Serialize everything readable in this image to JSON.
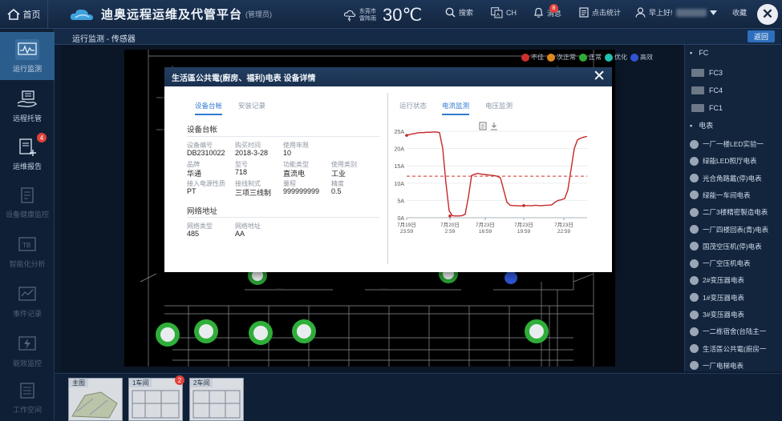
{
  "topbar": {
    "home_label": "首页",
    "title": "迪奥远程运维及代管平台",
    "subtitle": "(管理员)",
    "weather_city": "东莞市",
    "weather_desc": "雷阵雨",
    "temperature": "30℃",
    "search_label": "搜索",
    "lang_label": "CH",
    "messages_label": "消息",
    "messages_count": "8",
    "stats_label": "点击统计",
    "greeting": "早上好!",
    "favorite_label": "收藏"
  },
  "sidebar": {
    "items": [
      {
        "label": "运行监测"
      },
      {
        "label": "远程托管"
      },
      {
        "label": "运维报告",
        "badge": "4"
      },
      {
        "label": "设备健康监控"
      },
      {
        "label": "智能化分析"
      },
      {
        "label": "事件记录"
      },
      {
        "label": "能效监控"
      },
      {
        "label": "工作空间"
      }
    ]
  },
  "breadcrumb": {
    "text": "运行监测 - 传感器",
    "back_label": "返回"
  },
  "legend": [
    {
      "label": "不佳",
      "color": "#d0312d"
    },
    {
      "label": "次正常",
      "color": "#e08a1e"
    },
    {
      "label": "正常",
      "color": "#2fae3a"
    },
    {
      "label": "优化",
      "color": "#20c2b4"
    },
    {
      "label": "高效",
      "color": "#2f55d4"
    }
  ],
  "right_panel": {
    "group1": "FC",
    "fc_items": [
      "FC3",
      "FC4",
      "FC1"
    ],
    "group2": "电表",
    "meters": [
      "一厂一楼LED实验一",
      "绿能LED照厅电表",
      "光合角路戴(停)电表",
      "绿能一车间电表",
      "二厂3楼精密製造电表",
      "一厂四楼回表(青)电表",
      "国茂空压机(停)电表",
      "一厂空压机电表",
      "2#变压器电表",
      "1#变压器电表",
      "3#变压器电表",
      "一二栋宿舍(台陆主一",
      "生活區公共電(廚房一",
      "一厂电梯电表"
    ]
  },
  "bottom": {
    "thumbs": [
      {
        "label": "主图"
      },
      {
        "label": "1车间",
        "badge": "2"
      },
      {
        "label": "2车间"
      }
    ]
  },
  "modal": {
    "title": "生活區公共電(廚房、福利)电表 设备详情",
    "left_tabs": [
      "设备台帐",
      "安装记录"
    ],
    "section1": "设备台帐",
    "fields": [
      {
        "label": "设备编号",
        "value": "DB2310022"
      },
      {
        "label": "购买时间",
        "value": "2018-3-28"
      },
      {
        "label": "使用年限",
        "value": "10"
      },
      {
        "label": "品牌",
        "value": "华通"
      },
      {
        "label": "型号",
        "value": "718"
      },
      {
        "label": "功能类型",
        "value": "直流电"
      },
      {
        "label": "使用类别",
        "value": "工业"
      },
      {
        "label": "接入电源性质",
        "value": "PT"
      },
      {
        "label": "接线制式",
        "value": "三项三线制"
      },
      {
        "label": "量程",
        "value": "999999999"
      },
      {
        "label": "精度",
        "value": "0.5"
      }
    ],
    "section2": "网络地址",
    "net_fields": [
      {
        "label": "网络类型",
        "value": "485"
      },
      {
        "label": "网络地址",
        "value": "AA"
      }
    ],
    "right_tabs": [
      "运行状态",
      "电流监测",
      "电压监测"
    ],
    "active_right_tab": 1
  },
  "chart_data": {
    "type": "line",
    "y_ticks": [
      "25A",
      "20A",
      "15A",
      "10A",
      "5A",
      "0A"
    ],
    "ylim": [
      0,
      25
    ],
    "x_ticks": [
      [
        "7月19日",
        "23:59"
      ],
      [
        "7月20日",
        "2:59"
      ],
      [
        "7月23日",
        "16:59"
      ],
      [
        "7月23日",
        "19:59"
      ],
      [
        "7月23日",
        "22:59"
      ]
    ],
    "series": [
      {
        "x": [
          0,
          3,
          6,
          9,
          13,
          17,
          21,
          25,
          29,
          33,
          37,
          41,
          45,
          49,
          53,
          57,
          61,
          65,
          69,
          73,
          77,
          81,
          85,
          89,
          93,
          97,
          101,
          105,
          109,
          113,
          117,
          121,
          125,
          129,
          133,
          137,
          141,
          145,
          149,
          153,
          157,
          161,
          165,
          169,
          173,
          177,
          181,
          185,
          189,
          193,
          197,
          201,
          205,
          209,
          213,
          217,
          221,
          225
        ],
        "values": [
          23.8,
          24.0,
          24.2,
          24.3,
          24.5,
          24.6,
          24.6,
          24.7,
          24.7,
          24.8,
          24.8,
          24.6,
          20,
          10,
          2,
          0.6,
          0.5,
          0.5,
          0.6,
          1.0,
          6,
          12.2,
          12.6,
          12.8,
          12.6,
          12.5,
          12.4,
          12.3,
          12.2,
          12.0,
          11.5,
          8,
          4.5,
          3.6,
          3.5,
          3.5,
          3.4,
          3.5,
          3.5,
          3.5,
          3.5,
          3.6,
          3.5,
          3.5,
          3.6,
          3.6,
          3.7,
          4.5,
          5,
          5.2,
          5.5,
          8,
          14,
          20,
          22.5,
          23,
          23.3,
          23.5
        ]
      }
    ],
    "threshold": 12
  }
}
